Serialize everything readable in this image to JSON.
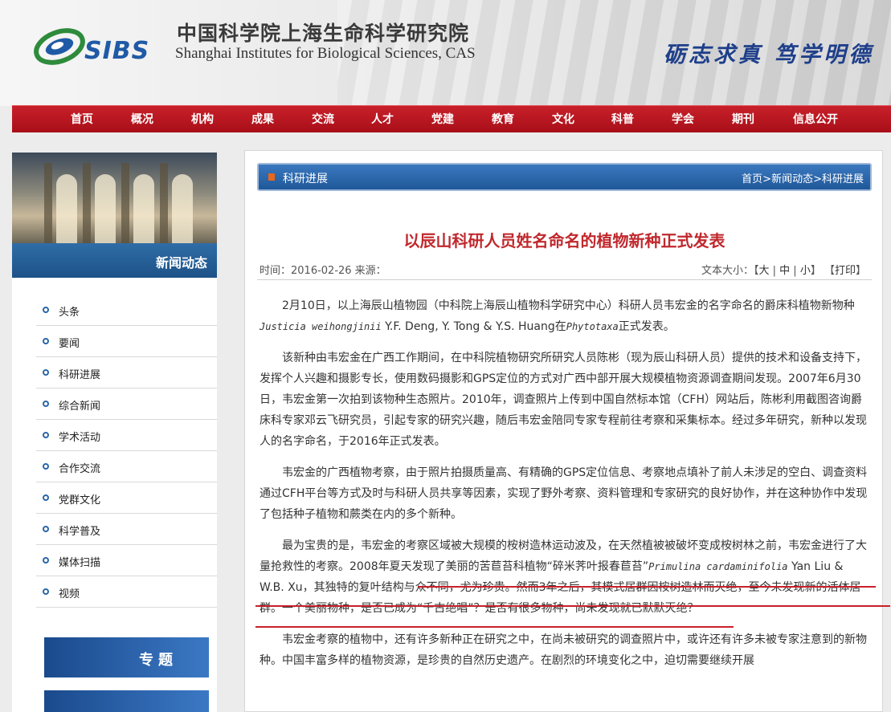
{
  "header": {
    "logo_text": "SIBS",
    "institute_cn": "中国科学院上海生命科学研究院",
    "institute_en": "Shanghai Institutes for Biological Sciences, CAS",
    "motto": "砺志求真 笃学明德"
  },
  "nav": {
    "items": [
      "首页",
      "概况",
      "机构",
      "成果",
      "交流",
      "人才",
      "党建",
      "教育",
      "文化",
      "科普",
      "学会",
      "期刊",
      "信息公开"
    ]
  },
  "sidebar": {
    "title": "新闻动态",
    "items": [
      "头条",
      "要闻",
      "科研进展",
      "综合新闻",
      "学术活动",
      "合作交流",
      "党群文化",
      "科学普及",
      "媒体扫描",
      "视频"
    ],
    "banner": "专题"
  },
  "main": {
    "section": "科研进展",
    "breadcrumb": {
      "home": "首页",
      "sep1": ">",
      "news": "新闻动态",
      "sep2": ">",
      "current": "科研进展"
    },
    "article_title": "以辰山科研人员姓名命名的植物新种正式发表",
    "time_label": "时间：2016-02-26  来源：",
    "font_size_label": "文本大小：",
    "size_large": "大",
    "size_medium": "中",
    "size_small": "小",
    "print_label": "打印",
    "paragraphs": {
      "p1_a": "2月10日，以上海辰山植物园（中科院上海辰山植物科学研究中心）科研人员韦宏金的名字命名的爵床科植物新物种",
      "p1_sp": "Justicia weihongjinii",
      "p1_b": " Y.F. Deng, Y. Tong & Y.S. Huang在",
      "p1_journal": "Phytotaxa",
      "p1_c": "正式发表。",
      "p2": "该新种由韦宏金在广西工作期间，在中科院植物研究所研究人员陈彬（现为辰山科研人员）提供的技术和设备支持下，发挥个人兴趣和摄影专长，使用数码摄影和GPS定位的方式对广西中部开展大规模植物资源调查期间发现。2007年6月30日，韦宏金第一次拍到该物种生态照片。2010年，调查照片上传到中国自然标本馆（CFH）网站后，陈彬利用截图咨询爵床科专家邓云飞研究员，引起专家的研究兴趣，随后韦宏金陪同专家专程前往考察和采集标本。经过多年研究，新种以发现人的名字命名，于2016年正式发表。",
      "p3": "韦宏金的广西植物考察，由于照片拍摄质量高、有精确的GPS定位信息、考察地点填补了前人未涉足的空白、调查资料通过CFH平台等方式及时与科研人员共享等因素，实现了野外考察、资料管理和专家研究的良好协作，并在这种协作中发现了包括种子植物和蕨类在内的多个新种。",
      "p4_a": "最为宝贵的是，韦宏金的考察区域被大规模的桉树造林运动波及，在天然植被被破坏变成桉树林之前，韦宏金进行了大量抢救性的考察。2008年夏天发现了美丽的苦苣苔科植物“碎米荠叶报春苣苔”",
      "p4_sp": "Primulina cardaminifolia",
      "p4_b": " Yan Liu & W.B. Xu，其独特的复叶结构与众不同，尤为珍贵。然而3年之后，其模式居群因桉树造林而灭绝，至今未发现新的活体居群。一个美丽物种，是否已成为“千古绝唱”？是否有很多物种，尚未发现就已默默灭绝？",
      "p5": "韦宏金考察的植物中，还有许多新种正在研究之中，在尚未被研究的调查照片中，或许还有许多未被专家注意到的新物种。中国丰富多样的植物资源，是珍贵的自然历史遗产。在剧烈的环境变化之中，迫切需要继续开展"
    }
  },
  "colors": {
    "nav_red": "#b8141d",
    "sidebar_blue": "#1d5288",
    "title_red": "#c0282d"
  }
}
